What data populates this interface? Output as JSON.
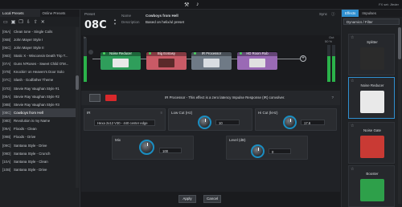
{
  "topbar": {
    "fx_set": "FX set: Jfeder"
  },
  "left_panel": {
    "tabs": [
      "Local Presets",
      "Online Presets"
    ],
    "presets": [
      {
        "num": "[06A]",
        "name": "Clean tone - Single Coils"
      },
      {
        "num": "[06B]",
        "name": "John Mayer Style I"
      },
      {
        "num": "[06C]",
        "name": "John Mayer Style II"
      },
      {
        "num": "[06D]",
        "name": "Static X - Wisconsin Death Trip T..."
      },
      {
        "num": "[07A]",
        "name": "Guns N'Roses - Sweet Child O'M..."
      },
      {
        "num": "[07B]",
        "name": "Knockin' on Heaven's Door Solo"
      },
      {
        "num": "[07C]",
        "name": "Slash - Godfather Theme"
      },
      {
        "num": "[07D]",
        "name": "Stevie Ray Vaughan Style #1"
      },
      {
        "num": "[08A]",
        "name": "Stevie Ray Vaughan Style #2"
      },
      {
        "num": "[08B]",
        "name": "Stevie Ray Vaughan Style #3"
      },
      {
        "num": "[08C]",
        "name": "Cowboys from Hell"
      },
      {
        "num": "[08D]",
        "name": "Revolution is my Name"
      },
      {
        "num": "[09A]",
        "name": "Floods - Clean"
      },
      {
        "num": "[09B]",
        "name": "Floods - Drive"
      },
      {
        "num": "[09C]",
        "name": "Santana Style - Drive"
      },
      {
        "num": "[09D]",
        "name": "Santana Style - Crunch"
      },
      {
        "num": "[10A]",
        "name": "Santana Style - Clean"
      },
      {
        "num": "[10B]",
        "name": "Santana Style - Drive"
      }
    ],
    "selected_index": 10
  },
  "preset_header": {
    "label": "Preset",
    "number": "08C",
    "name_key": "Name",
    "name_value": "Cowboys from Hell",
    "desc_key": "Description",
    "desc_value": "Based on helix/ul preset",
    "sync_label": "Sync",
    "sync_icon": "info-icon"
  },
  "chain": {
    "in_label": "In",
    "out_label": "Out",
    "out_level": "50 %",
    "blocks": [
      {
        "name": "Noise Reducer",
        "color": "#2f9e5b",
        "pedal_color": "#e8e8e8"
      },
      {
        "name": "Big Ecstasy",
        "color": "#c95a66",
        "pedal_color": "#5b2a2a"
      },
      {
        "name": "IR Processor",
        "color": "#6f7a86",
        "pedal_color": "#d9dde2"
      },
      {
        "name": "HD Room Rub",
        "color": "#9a6ab5",
        "pedal_color": "#e0e0e0"
      }
    ]
  },
  "detail": {
    "description": "IR Processor - This effect is a zero latency Impulse Response (IR) convolver.",
    "help": "?",
    "ir": {
      "label": "IR",
      "value": "Hexa 2x12 V30 - 440 center edge"
    },
    "low_cut": {
      "label": "Low Cut (Hz)",
      "value": "10"
    },
    "hi_cut": {
      "label": "Hi Cut (kHz)",
      "value": "17.6"
    },
    "mix": {
      "label": "Mix",
      "value": "100"
    },
    "level": {
      "label": "Level (dB)",
      "value": "0"
    }
  },
  "buttons": {
    "apply": "Apply",
    "cancel": "Cancel"
  },
  "right_panel": {
    "tabs": [
      "Effects",
      "Impulses"
    ],
    "category": "Dynamics / Filter",
    "effects": [
      {
        "name": "Splitter",
        "color": "#2b2b2b"
      },
      {
        "name": "Noise Reducer",
        "color": "#e9e9e9"
      },
      {
        "name": "Noise Gate",
        "color": "#c93a34"
      },
      {
        "name": "Booster",
        "color": "#2ea04a"
      }
    ],
    "selected_index": 1
  }
}
